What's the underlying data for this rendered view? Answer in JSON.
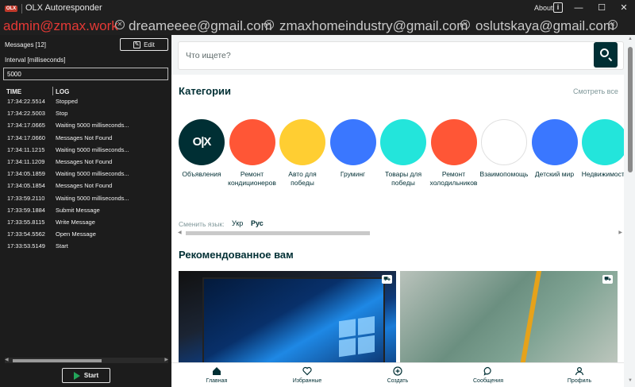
{
  "app": {
    "title": "OLX Autoresponder",
    "logo_text": "OLX",
    "about_label": "About",
    "about_icon": "info-icon"
  },
  "window_controls": {
    "minimize": "—",
    "maximize": "☐",
    "close": "✕"
  },
  "accounts": [
    {
      "email": "admin@zmax.work",
      "active": true
    },
    {
      "email": "dreameeee@gmail.com",
      "active": false
    },
    {
      "email": "zmaxhomeindustry@gmail.com",
      "active": false
    },
    {
      "email": "oslutskaya@gmail.com",
      "active": false
    }
  ],
  "left_panel": {
    "messages_label": "Messages [12]",
    "edit_label": "Edit",
    "interval_label": "Interval [milliseconds]",
    "interval_value": "5000",
    "columns": {
      "time": "TIME",
      "log": "LOG"
    },
    "log": [
      {
        "time": "17:34:22.5514",
        "message": "Stopped"
      },
      {
        "time": "17:34:22.5003",
        "message": "Stop"
      },
      {
        "time": "17:34:17.0665",
        "message": "Waiting 5000 milliseconds..."
      },
      {
        "time": "17:34:17.0660",
        "message": "Messages Not Found"
      },
      {
        "time": "17:34:11.1215",
        "message": "Waiting 5000 milliseconds..."
      },
      {
        "time": "17:34:11.1209",
        "message": "Messages Not Found"
      },
      {
        "time": "17:34:05.1859",
        "message": "Waiting 5000 milliseconds..."
      },
      {
        "time": "17:34:05.1854",
        "message": "Messages Not Found"
      },
      {
        "time": "17:33:59.2110",
        "message": "Waiting 5000 milliseconds..."
      },
      {
        "time": "17:33:59.1884",
        "message": "Submit Message"
      },
      {
        "time": "17:33:55.8115",
        "message": "Write Message"
      },
      {
        "time": "17:33:54.5562",
        "message": "Open Message"
      },
      {
        "time": "17:33:53.5149",
        "message": "Start"
      }
    ],
    "start_label": "Start"
  },
  "web": {
    "search_placeholder": "Что ищете?",
    "categories_title": "Категории",
    "see_all": "Смотреть все",
    "categories": [
      {
        "name": "Объявления",
        "color": "#002f34"
      },
      {
        "name": "Ремонт кондиционеров",
        "color": "#ff5636"
      },
      {
        "name": "Авто для победы",
        "color": "#ffce32"
      },
      {
        "name": "Груминг",
        "color": "#3a77ff"
      },
      {
        "name": "Товары для победы",
        "color": "#23e5db"
      },
      {
        "name": "Ремонт холодильников",
        "color": "#ff5636"
      },
      {
        "name": "Взаимопомощь",
        "color": "#ffffff"
      },
      {
        "name": "Детский мир",
        "color": "#3a77ff"
      },
      {
        "name": "Недвижимость",
        "color": "#23e5db"
      }
    ],
    "language_label": "Сменить язык:",
    "lang_ukr": "Укр",
    "lang_rus": "Рус",
    "recommended_title": "Рекомендованное вам",
    "nav": [
      {
        "label": "Главная",
        "icon": "home-icon"
      },
      {
        "label": "Избранные",
        "icon": "heart-icon"
      },
      {
        "label": "Создать",
        "icon": "plus-circle-icon"
      },
      {
        "label": "Сообщения",
        "icon": "chat-icon"
      },
      {
        "label": "Профиль",
        "icon": "user-icon"
      }
    ]
  }
}
